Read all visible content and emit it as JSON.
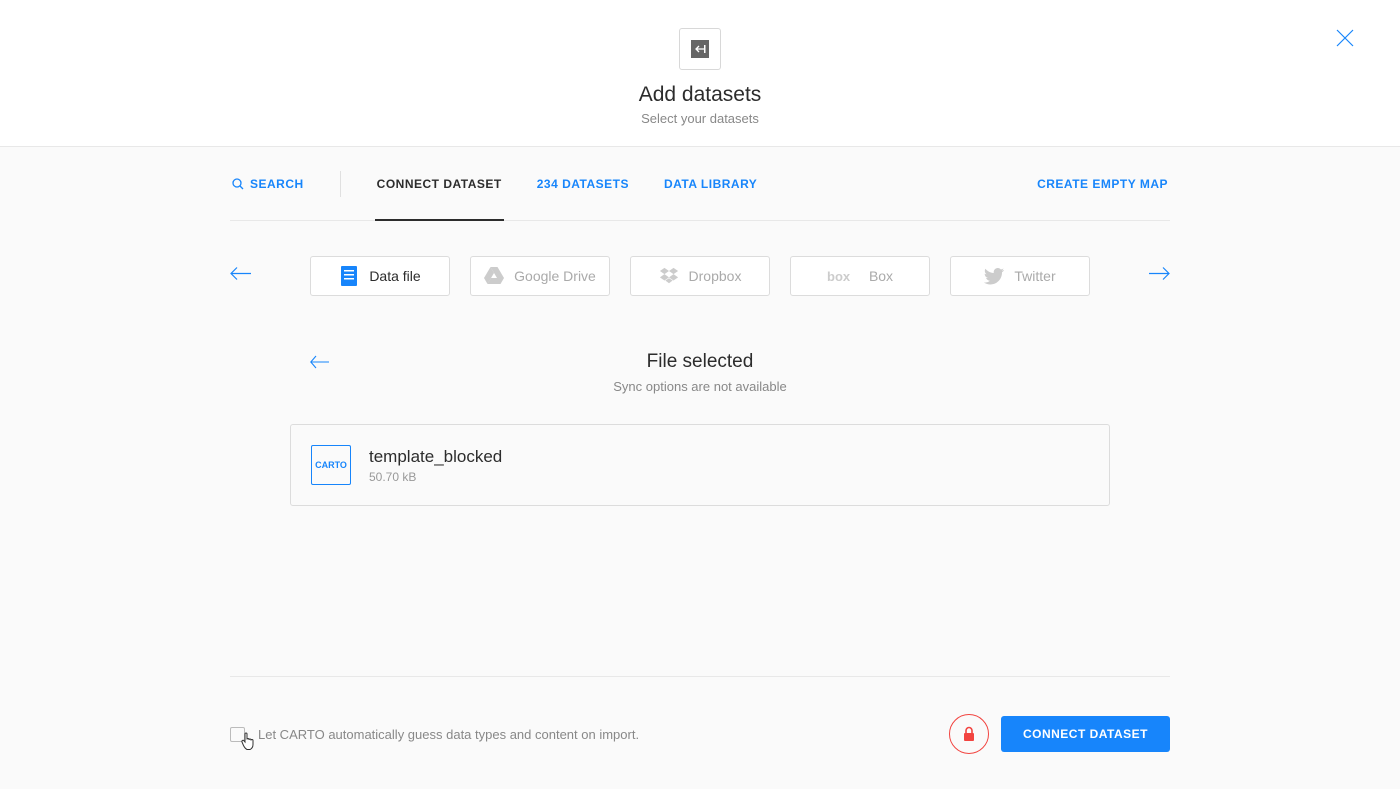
{
  "header": {
    "title": "Add datasets",
    "subtitle": "Select your datasets"
  },
  "tabs": {
    "search": "SEARCH",
    "connect": "CONNECT DATASET",
    "counts": "234 DATASETS",
    "library": "DATA LIBRARY",
    "create_empty": "CREATE EMPTY MAP"
  },
  "sources": {
    "data_file": "Data file",
    "google_drive": "Google Drive",
    "dropbox": "Dropbox",
    "box": "Box",
    "twitter": "Twitter"
  },
  "file_section": {
    "title": "File selected",
    "subtitle": "Sync options are not available"
  },
  "file": {
    "badge": "CARTO",
    "name": "template_blocked",
    "size": "50.70 kB"
  },
  "footer": {
    "checkbox_label": "Let CARTO automatically guess data types and content on import.",
    "connect_button": "CONNECT DATASET"
  }
}
